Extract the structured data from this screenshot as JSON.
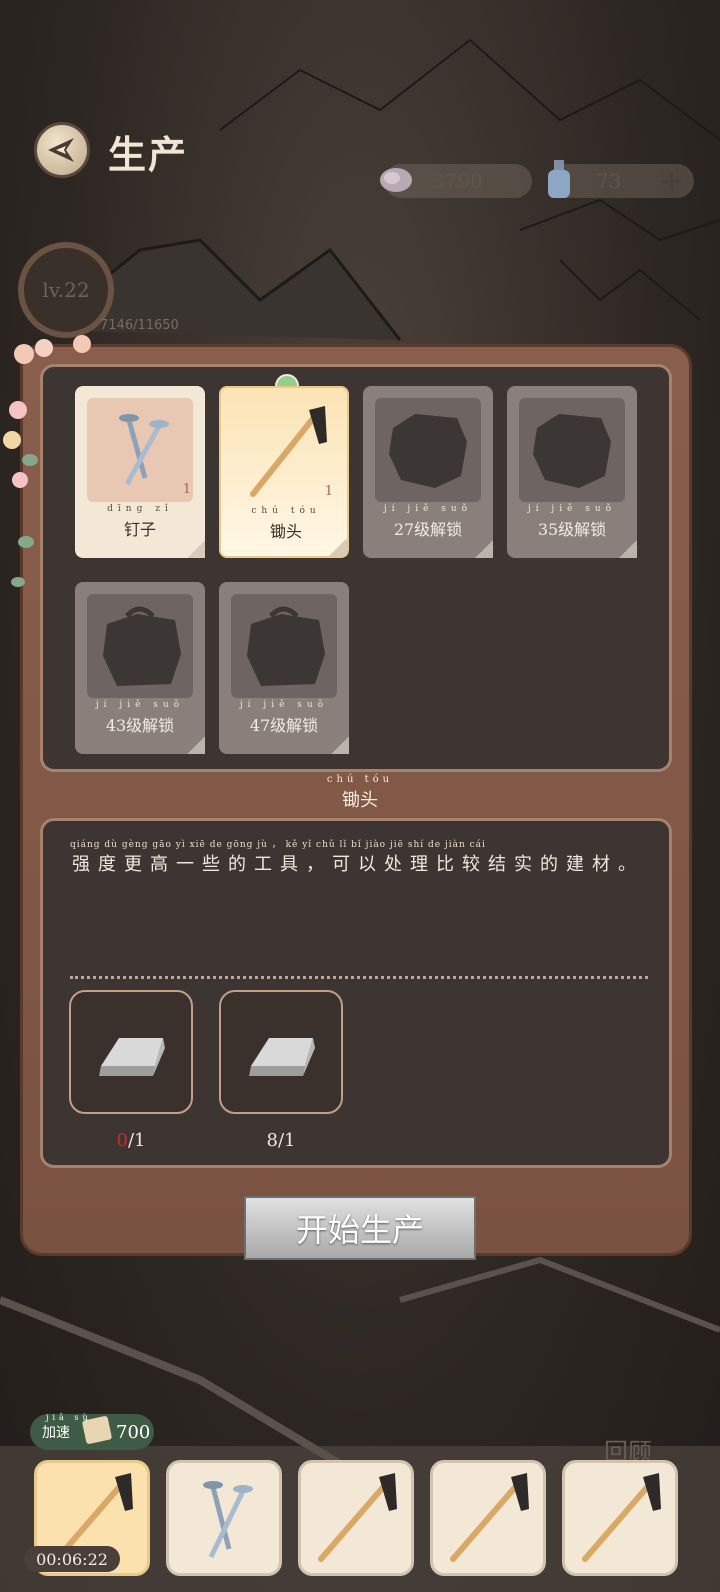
{
  "header": {
    "title": "生产",
    "back_icon": "compass-back-icon"
  },
  "resources": [
    {
      "icon": "meat-icon",
      "value": "3790"
    },
    {
      "icon": "potion-bottle-icon",
      "value": "73",
      "plus": "+"
    }
  ],
  "player": {
    "level": "lv.22",
    "exp": "7146/11650"
  },
  "items": [
    {
      "name": "钉子",
      "pinyin": "dīng zǐ",
      "count": "1",
      "state": "normal",
      "icon": "nail-icon"
    },
    {
      "name": "锄头",
      "pinyin": "chú tóu",
      "count": "1",
      "state": "selected",
      "icon": "hoe-icon"
    },
    {
      "name": "27级解锁",
      "pinyin": "jí jiě suǒ",
      "state": "locked",
      "icon": "rock-silhouette-icon"
    },
    {
      "name": "35级解锁",
      "pinyin": "jí jiě suǒ",
      "state": "locked",
      "icon": "rock-silhouette-icon"
    },
    {
      "name": "43级解锁",
      "pinyin": "jí jiě suǒ",
      "state": "locked",
      "icon": "backpack-silhouette-icon"
    },
    {
      "name": "47级解锁",
      "pinyin": "jí jiě suǒ",
      "state": "locked",
      "icon": "backpack-silhouette-icon"
    }
  ],
  "selected": {
    "name": "锄头",
    "pinyin": "chú tóu",
    "description": "强度更高一些的工具，可以处理比较结实的建材。",
    "description_pinyin": "qiáng dù gèng gāo yì xiē de gōng jù ， kě yǐ chǔ lǐ bǐ jiào jiē shí de jiàn cái",
    "materials": [
      {
        "icon": "iron-ingot-icon",
        "have": "0",
        "need": "/1"
      },
      {
        "icon": "iron-ingot-icon",
        "have": "8",
        "need": "/1"
      }
    ]
  },
  "start_button": "开始生产",
  "queue": {
    "speedup_label": "加速",
    "speedup_pinyin": "jiā sù",
    "speedup_cost": "700",
    "timer": "00:06:22",
    "slots": [
      "hoe-icon",
      "nail-icon",
      "hoe-icon",
      "hoe-icon",
      "hoe-icon"
    ],
    "review": "回顾"
  },
  "colors": {
    "panel": "#8a5e4c",
    "dark_box": "#3d3532",
    "selected_card": "#fbe3b4",
    "speedup": "#3f5a45",
    "need_red": "#d02a22"
  }
}
